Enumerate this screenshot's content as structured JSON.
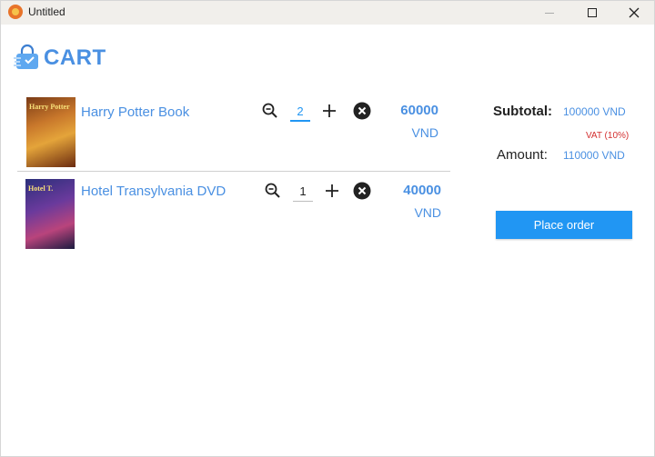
{
  "window": {
    "title": "Untitled"
  },
  "header": {
    "title": "CART",
    "logo_icon": "shopping-bag-icon"
  },
  "items": [
    {
      "name": "Harry Potter Book",
      "cover_text": "Harry Potter",
      "quantity": "2",
      "price": "60000",
      "currency": "VND"
    },
    {
      "name": "Hotel Transylvania DVD",
      "cover_text": "Hotel T.",
      "quantity": "1",
      "price": "40000",
      "currency": "VND"
    }
  ],
  "summary": {
    "subtotal_label": "Subtotal:",
    "subtotal_value": "100000 VND",
    "vat_label": "VAT (10%)",
    "amount_label": "Amount:",
    "amount_value": "110000 VND"
  },
  "actions": {
    "place_order": "Place order"
  },
  "colors": {
    "accent": "#4a90e2",
    "primary_button": "#2196f3",
    "vat": "#d32f2f"
  }
}
